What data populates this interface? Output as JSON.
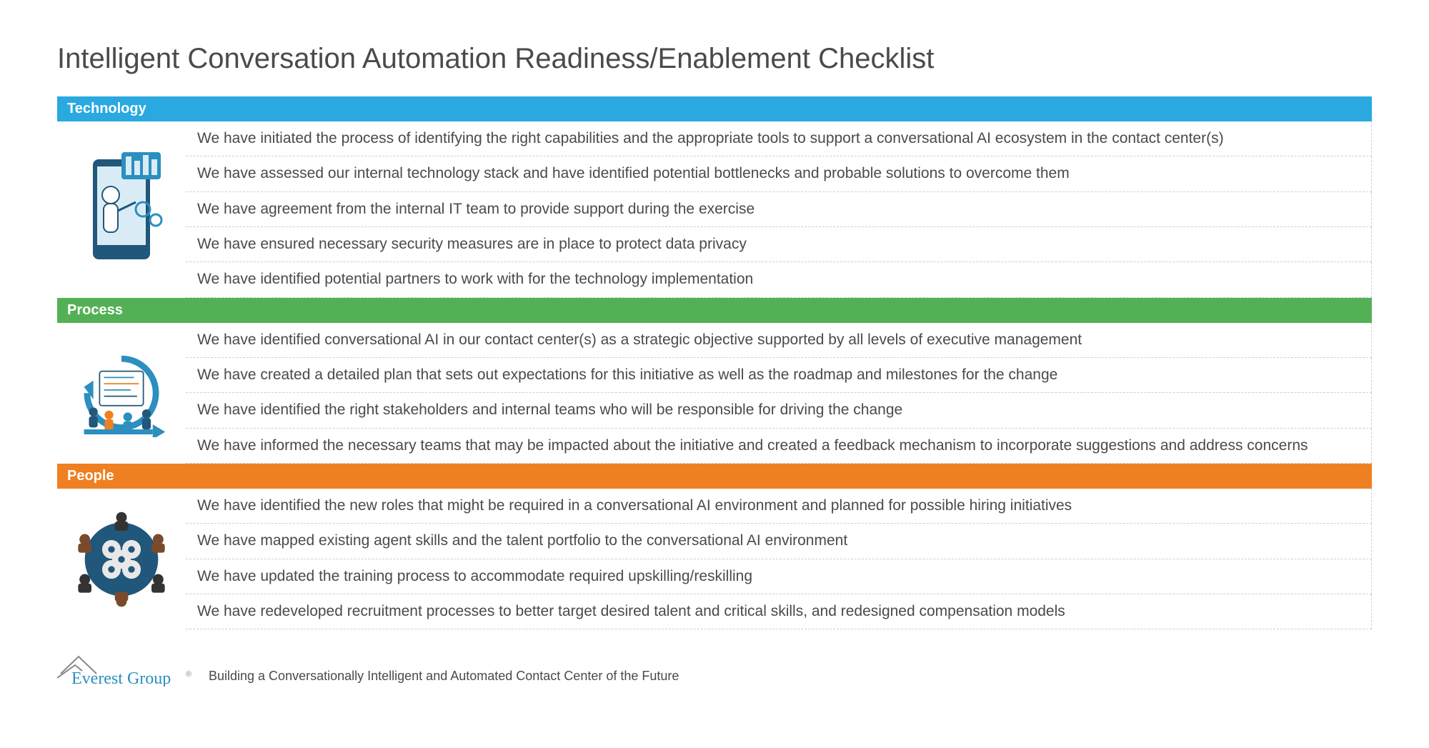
{
  "title": "Intelligent Conversation Automation Readiness/Enablement Checklist",
  "sections": [
    {
      "name": "Technology",
      "color": "blue",
      "items": [
        "We have initiated the process of identifying the right capabilities and the appropriate tools to support a conversational AI ecosystem in the contact center(s)",
        "We have assessed our internal technology stack and have identified potential bottlenecks and probable solutions to overcome them",
        "We have agreement from the internal IT team to provide support during the exercise",
        "We have ensured necessary security measures are in place to protect data privacy",
        "We have identified potential partners to work with for the technology implementation"
      ]
    },
    {
      "name": "Process",
      "color": "green",
      "items": [
        "We have identified conversational AI in our contact center(s) as a strategic objective supported by all levels of executive management",
        "We have created a detailed plan that sets out expectations for this initiative as well as the roadmap and milestones for the change",
        "We have identified the right stakeholders and internal teams who will be responsible for driving the change",
        "We have informed the necessary teams that may be impacted about the initiative and created a feedback mechanism to incorporate suggestions and address concerns"
      ]
    },
    {
      "name": "People",
      "color": "orange",
      "items": [
        "We have identified the new roles that might be required in a conversational AI environment and planned for possible hiring initiatives",
        "We have mapped existing agent skills and the talent portfolio to the conversational AI environment",
        "We have updated the training process to accommodate required upskilling/reskilling",
        "We have redeveloped recruitment processes to better target desired talent and critical skills, and redesigned compensation models"
      ]
    }
  ],
  "footer": {
    "company": "Everest Group",
    "registered": "®",
    "tagline": "Building a Conversationally Intelligent and Automated Contact Center of the Future"
  }
}
